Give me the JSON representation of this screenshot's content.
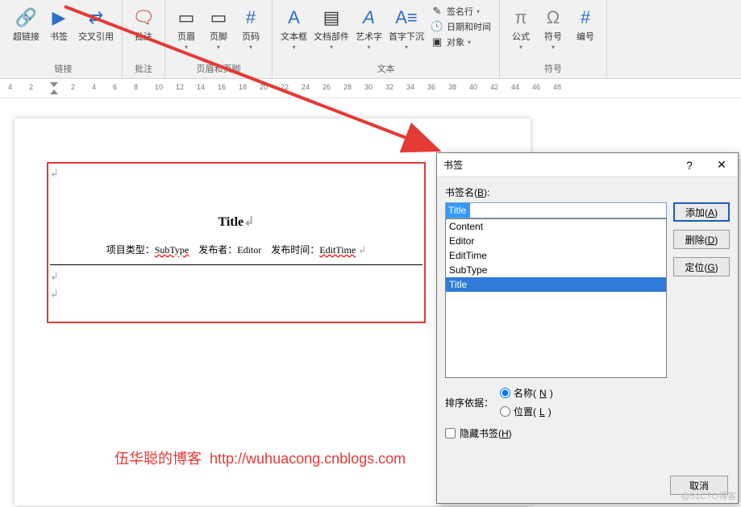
{
  "ribbon": {
    "groups": {
      "link": {
        "label": "链接",
        "hyperlink": "超链接",
        "bookmark": "书签",
        "crossref": "交叉引用"
      },
      "comment": {
        "label": "批注",
        "comment": "批注"
      },
      "headerfooter": {
        "label": "页眉和页脚",
        "header": "页眉",
        "footer": "页脚",
        "pagenum": "页码"
      },
      "text": {
        "label": "文本",
        "textbox": "文本框",
        "quickparts": "文档部件",
        "wordart": "艺术字",
        "dropcap": "首字下沉",
        "signature": "签名行",
        "datetime": "日期和时间",
        "object": "对象"
      },
      "symbols": {
        "label": "符号",
        "equation": "公式",
        "symbol": "符号",
        "number": "编号"
      }
    }
  },
  "ruler": {
    "ticks": [
      4,
      2,
      "",
      2,
      4,
      6,
      8,
      10,
      12,
      14,
      16,
      18,
      20,
      22,
      24,
      26,
      28,
      30,
      32,
      34,
      36,
      38,
      40,
      42,
      44,
      46,
      48
    ]
  },
  "document": {
    "title": "Title",
    "meta": {
      "type_label": "项目类型：",
      "type_value": "SubType",
      "editor_label": "发布者：",
      "editor_value": "Editor",
      "time_label": "发布时间：",
      "time_value": "EditTime"
    }
  },
  "dialog": {
    "title": "书签",
    "name_label": "书签名(B):",
    "name_value": "Title",
    "items": [
      "Content",
      "Editor",
      "EditTime",
      "SubType",
      "Title"
    ],
    "selected": "Title",
    "buttons": {
      "add": "添加(A)",
      "delete": "删除(D)",
      "goto": "定位(G)",
      "cancel": "取消"
    },
    "sort": {
      "label": "排序依据：",
      "by_name": "名称(N)",
      "by_location": "位置(L)",
      "selected": "name"
    },
    "hidden": {
      "label": "隐藏书签(H)",
      "checked": false
    }
  },
  "blog": {
    "text1": "伍华聪的博客",
    "text2": "http://wuhuacong.cnblogs.com"
  },
  "watermark": "@51CTO博客"
}
